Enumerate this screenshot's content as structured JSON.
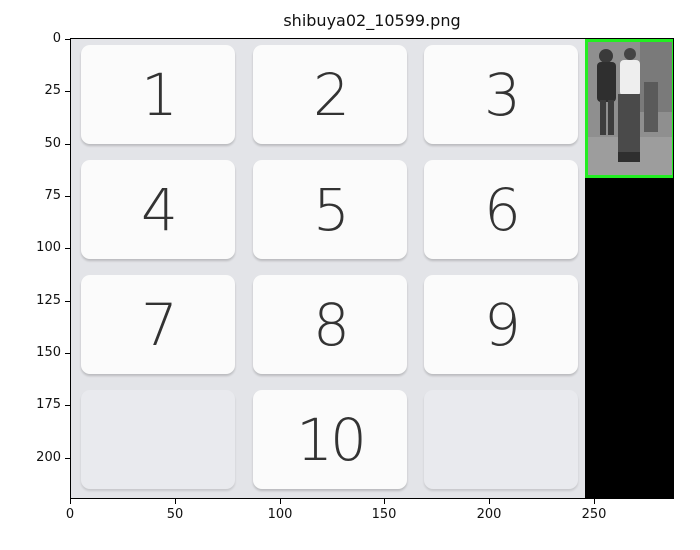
{
  "title": "shibuya02_10599.png",
  "keypad": {
    "keys": [
      "1",
      "2",
      "3",
      "4",
      "5",
      "6",
      "7",
      "8",
      "9",
      "",
      "10",
      ""
    ]
  },
  "thumbnail": {
    "border_color": "#22ee22"
  },
  "axes": {
    "x_ticks": [
      "0",
      "50",
      "100",
      "150",
      "200",
      "250"
    ],
    "y_ticks": [
      "0",
      "25",
      "50",
      "75",
      "100",
      "125",
      "150",
      "175",
      "200"
    ]
  }
}
